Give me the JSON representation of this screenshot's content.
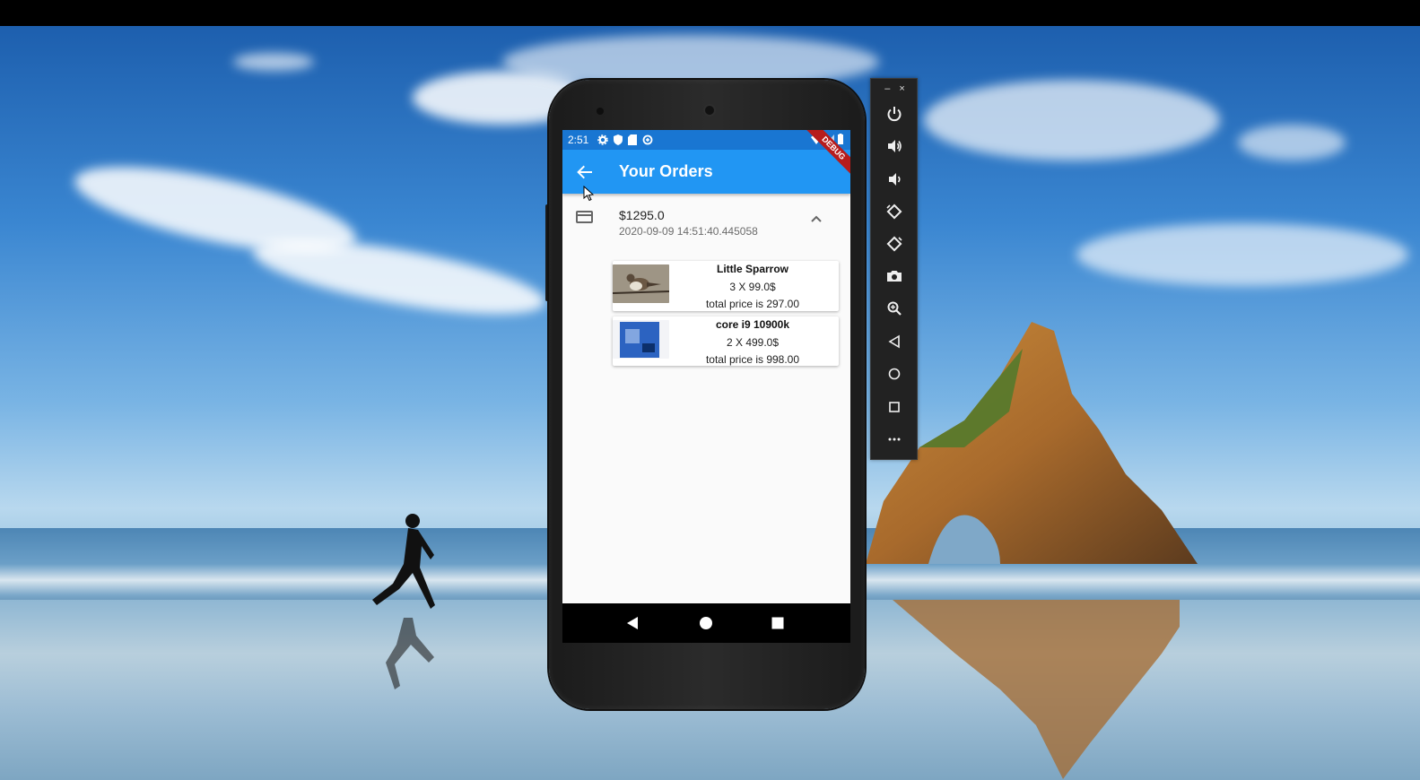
{
  "phone": {
    "status_bar": {
      "time": "2:51"
    },
    "app_bar": {
      "title": "Your Orders",
      "debug_banner": "DEBUG"
    },
    "order": {
      "amount": "$1295.0",
      "date": "2020-09-09 14:51:40.445058",
      "products": [
        {
          "name": "Little Sparrow",
          "quantity_line": "3 X 99.0$",
          "total_line": "total price is 297.00",
          "image": "sparrow-photo"
        },
        {
          "name": "core i9 10900k",
          "quantity_line": "2 X 499.0$",
          "total_line": "total price is 998.00",
          "image": "cpu-box-photo"
        }
      ]
    },
    "nav_bar": {
      "back": "back-triangle-icon",
      "home": "home-circle-icon",
      "recents": "recents-square-icon"
    }
  },
  "emulator_toolbar": {
    "minimize": "–",
    "close": "×",
    "buttons": [
      "power-icon",
      "volume-up-icon",
      "volume-down-icon",
      "rotate-left-icon",
      "rotate-right-icon",
      "camera-icon",
      "zoom-icon",
      "back-icon",
      "home-icon",
      "overview-icon",
      "more-icon"
    ]
  },
  "colors": {
    "status_bar": "#1976d2",
    "app_bar": "#2196f3",
    "screen_bg": "#fafafa",
    "toolbar_bg": "#222222"
  }
}
